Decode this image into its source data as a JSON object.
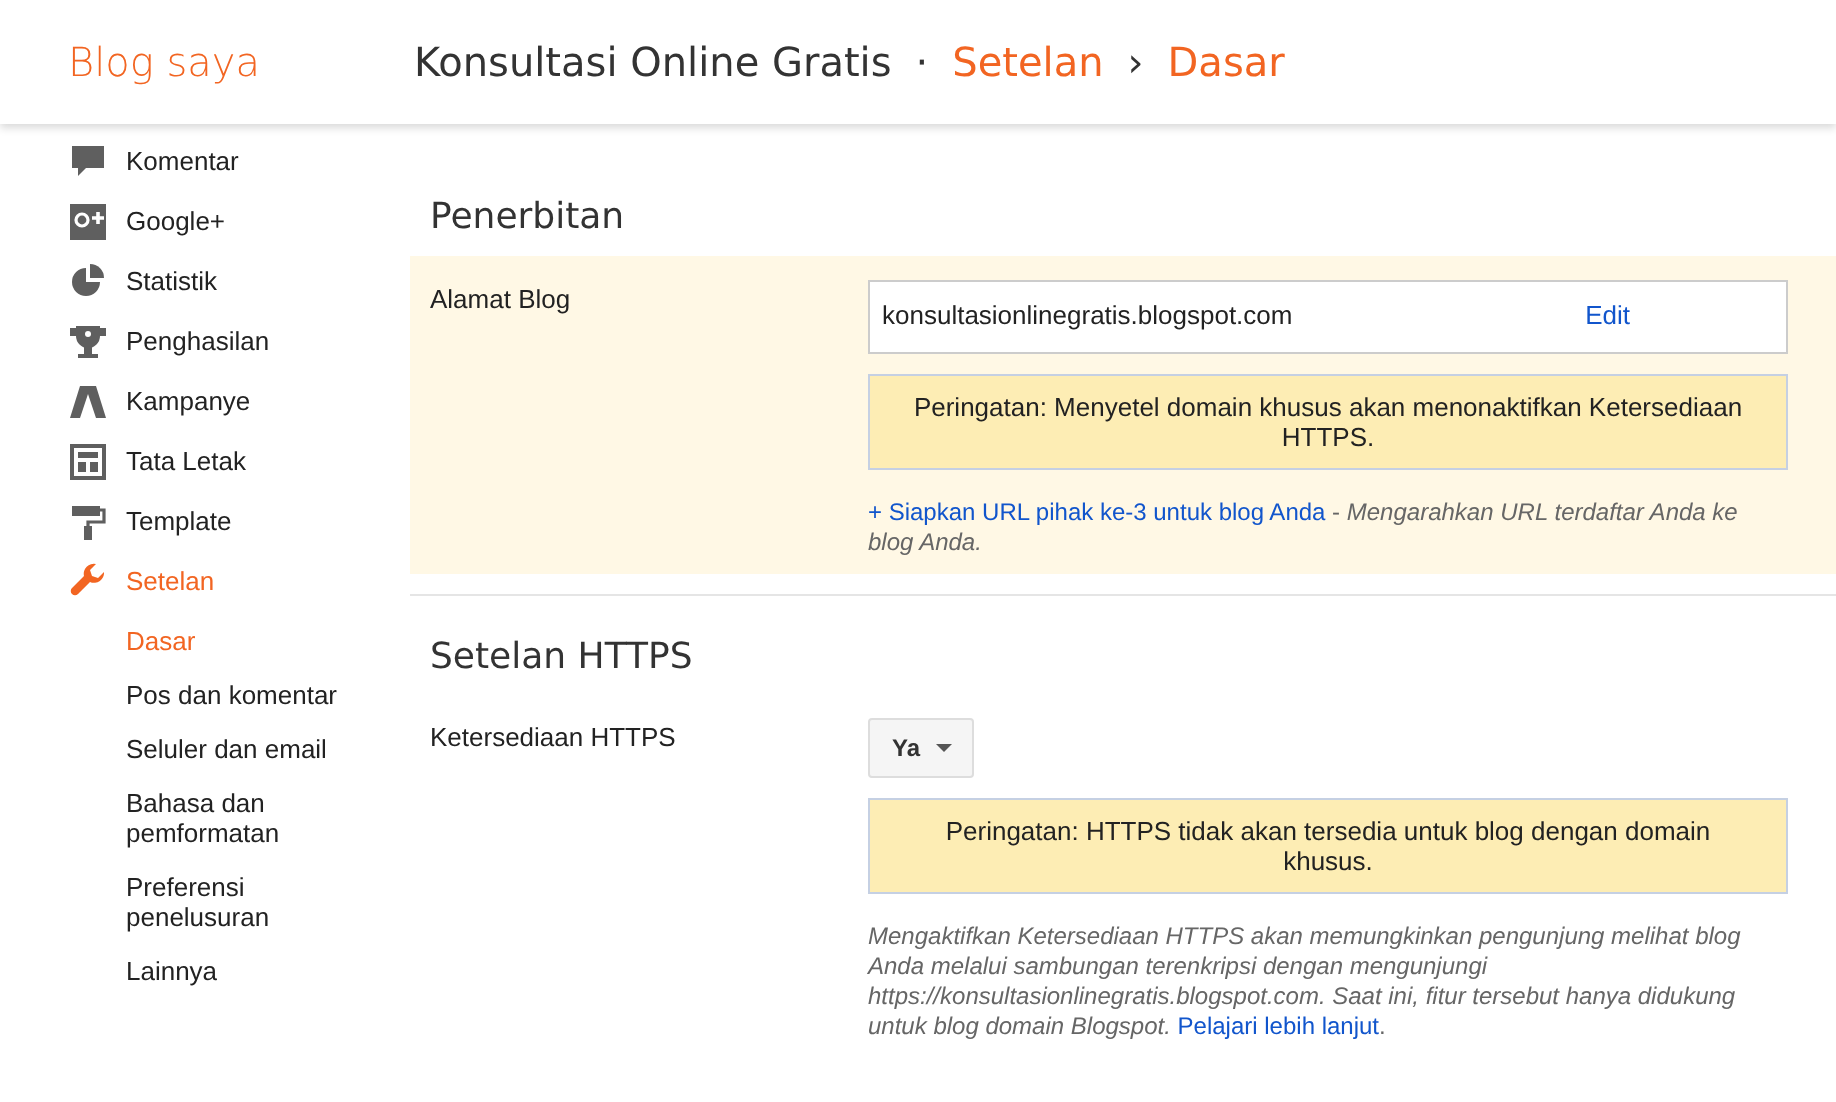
{
  "header": {
    "app_title": "Blog saya",
    "blog_title": "Konsultasi Online Gratis",
    "separator": "·",
    "section": "Setelan",
    "chevron": "›",
    "page": "Dasar"
  },
  "sidebar": {
    "items": [
      {
        "label": "Komentar",
        "selected": false
      },
      {
        "label": "Google+",
        "selected": false
      },
      {
        "label": "Statistik",
        "selected": false
      },
      {
        "label": "Penghasilan",
        "selected": false
      },
      {
        "label": "Kampanye",
        "selected": false
      },
      {
        "label": "Tata Letak",
        "selected": false
      },
      {
        "label": "Template",
        "selected": false
      },
      {
        "label": "Setelan",
        "selected": true,
        "children": [
          {
            "label": "Dasar",
            "selected": true
          },
          {
            "label": "Pos dan komentar",
            "selected": false
          },
          {
            "label": "Seluler dan email",
            "selected": false
          },
          {
            "label": "Bahasa dan pemformatan",
            "selected": false
          },
          {
            "label": "Preferensi penelusuran",
            "selected": false
          },
          {
            "label": "Lainnya",
            "selected": false
          }
        ]
      }
    ]
  },
  "sections": [
    {
      "title": "Penerbitan",
      "highlighted": true,
      "label": "Alamat Blog",
      "address": "konsultasionlinegratis.blogspot.com",
      "edit": "Edit",
      "warning": "Peringatan: Menyetel domain khusus akan menonaktifkan Ketersediaan HTTPS.",
      "help_link": "+ Siapkan URL pihak ke-3 untuk blog Anda",
      "help_text": " - *Mengarahkan URL terdaftar Anda ke blog Anda.*"
    },
    {
      "title": "Setelan HTTPS",
      "highlighted": false,
      "label": "Ketersediaan HTTPS",
      "dropdown": "Ya",
      "warning": "Peringatan: HTTPS tidak akan tersedia untuk blog dengan domain khusus.",
      "help_text": "*Mengaktifkan Ketersediaan HTTPS akan memungkinkan pengunjung melihat blog Anda melalui sambungan terenkripsi dengan mengunjungi https://konsultasionlinegratis.blogspot.com. Saat ini, fitur tersebut hanya didukung untuk blog domain Blogspot.* ",
      "help_link": "Pelajari lebih lanjut",
      "help_tail": "."
    }
  ]
}
